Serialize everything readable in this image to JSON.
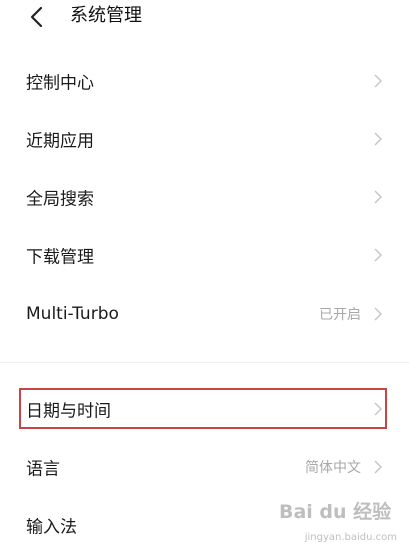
{
  "header": {
    "back_icon": "chevron-left-icon",
    "title": "系统管理"
  },
  "items": [
    {
      "label": "控制中心",
      "value": ""
    },
    {
      "label": "近期应用",
      "value": ""
    },
    {
      "label": "全局搜索",
      "value": ""
    },
    {
      "label": "下载管理",
      "value": ""
    },
    {
      "label": "Multi-Turbo",
      "value": "已开启"
    },
    {
      "label": "日期与时间",
      "value": ""
    },
    {
      "label": "语言",
      "value": "简体中文"
    },
    {
      "label": "输入法",
      "value": ""
    }
  ],
  "annotation": {
    "highlight_color": "#c94545",
    "highlighted_item": "日期与时间"
  },
  "watermark": {
    "logo": "Bai du 经验",
    "url": "jingyan.baidu.com"
  }
}
